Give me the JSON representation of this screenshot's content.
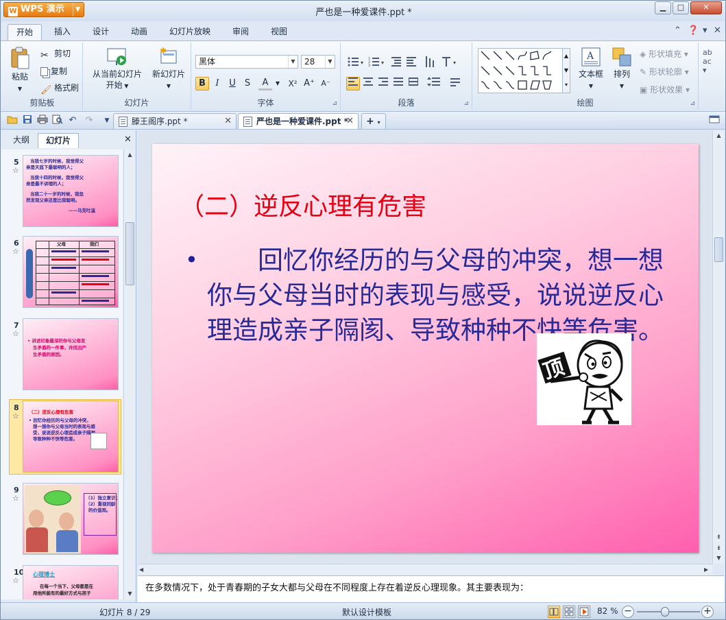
{
  "app": {
    "name": "WPS 演示",
    "window_title": "严也是一种爱课件.ppt *"
  },
  "menu": {
    "tabs": [
      "开始",
      "插入",
      "设计",
      "动画",
      "幻灯片放映",
      "审阅",
      "视图"
    ],
    "active_index": 0
  },
  "ribbon": {
    "clipboard": {
      "label": "剪贴板",
      "paste": "粘贴",
      "cut": "剪切",
      "copy": "复制",
      "format_painter": "格式刷"
    },
    "slides": {
      "label": "幻灯片",
      "from_current_line1": "从当前幻灯片",
      "from_current_line2": "开始",
      "new_slide": "新幻灯片"
    },
    "font": {
      "label": "字体",
      "font_name": "黑体",
      "font_size": "28",
      "bold": "B",
      "italic": "I",
      "underline": "U",
      "shadow": "S",
      "color": "A",
      "superscript": "X²",
      "grow": "A⁺",
      "shrink": "A⁻"
    },
    "paragraph": {
      "label": "段落"
    },
    "drawing": {
      "label": "绘图",
      "textbox": "文本框",
      "arrange": "排列",
      "shape_fill": "形状填充",
      "shape_outline": "形状轮廓",
      "shape_effects": "形状效果"
    },
    "accent_color": "#f7c95b"
  },
  "doc_tabs": [
    {
      "label": "滕王阁序.ppt *",
      "active": false
    },
    {
      "label": "严也是一种爱课件.ppt *",
      "active": true
    }
  ],
  "left_panel": {
    "tabs": [
      "大纲",
      "幻灯片"
    ],
    "active_tab": 1,
    "thumbnails": [
      {
        "num": "5",
        "lines": [
          "当我七岁的时候，我觉得父",
          "亲是天底下最聪明的人；",
          "当我十四的时候，我觉得父",
          "亲是最不讲理的人；",
          "当我二十一岁的时候，我忽",
          "然发现父亲还是比我聪明。",
          "——马克吐温"
        ]
      },
      {
        "num": "6",
        "lines": [
          "父母",
          "我们"
        ]
      },
      {
        "num": "7",
        "lines": [
          "• 讲述印象最深的你与父母发",
          "生矛盾的一件事，并找出产",
          "生矛盾的原因。"
        ]
      },
      {
        "num": "8",
        "lines": [
          "（二）逆反心理有危害",
          "• 回忆你经历的与父母的冲突，",
          "想一想你与父母当时的表现与感",
          "受，说说逆反心理造成亲子隔阂、",
          "导致种种不快等危害。"
        ],
        "selected": true
      },
      {
        "num": "9",
        "lines": [
          "（1）独立意识；",
          "（2）重视同龄",
          "的价值观。"
        ]
      },
      {
        "num": "10",
        "lines": [
          "心理博士",
          "在每一个当下，父母都是在",
          "用他所能有的最好方式与孩子"
        ]
      }
    ]
  },
  "slide": {
    "title": "（二）逆反心理有危害",
    "bullet": "•",
    "body": "　　回忆你经历的与父母的冲突，想一想你与父母当时的表现与感受，说说逆反心理造成亲子隔阂、导致种种不快等危害。",
    "clip_char": "顶",
    "title_color": "#e60012",
    "body_color": "#2a2a96"
  },
  "notes": {
    "text": "在多数情况下，处于青春期的子女大都与父母在不同程度上存在着逆反心理现象。其主要表现为："
  },
  "status": {
    "slide_counter": "幻灯片 8 / 29",
    "template": "默认设计模板",
    "zoom": "82 %",
    "zoom_fraction": 0.45
  }
}
